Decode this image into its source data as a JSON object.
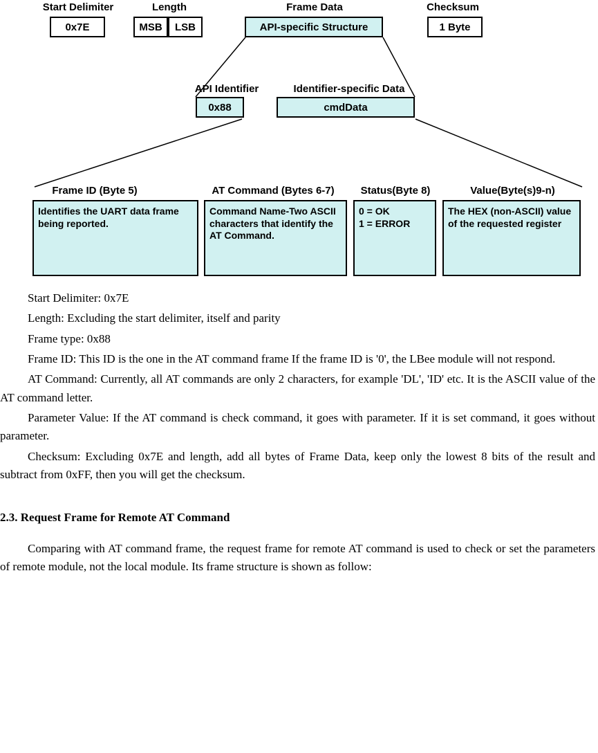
{
  "diagram": {
    "row1": {
      "startDelim": {
        "label": "Start Delimiter",
        "value": "0x7E"
      },
      "length": {
        "label": "Length",
        "msb": "MSB",
        "lsb": "LSB"
      },
      "frameData": {
        "label": "Frame Data",
        "value": "API-specific Structure"
      },
      "checksum": {
        "label": "Checksum",
        "value": "1 Byte"
      }
    },
    "row2": {
      "apiIdentifier": {
        "label": "API Identifier",
        "value": "0x88"
      },
      "identifierData": {
        "label": "Identifier-specific Data",
        "value": "cmdData"
      }
    },
    "row3": {
      "frameId": {
        "label": "Frame ID (Byte 5)",
        "text": "Identifies the UART data frame being reported."
      },
      "atCommand": {
        "label": "AT Command (Bytes 6-7)",
        "text": "Command Name-Two ASCII characters that identify the  AT Command."
      },
      "status": {
        "label": "Status(Byte 8)",
        "text": "0 = OK\n1 = ERROR"
      },
      "value": {
        "label": "Value(Byte(s)9-n)",
        "text": "The HEX (non-ASCII) value of the requested register"
      }
    }
  },
  "definitions": {
    "startDelim": "Start Delimiter: 0x7E",
    "length": "Length: Excluding the start delimiter, itself and parity",
    "frameType": "Frame type: 0x88",
    "frameId": "Frame ID: This ID is the one in the AT command frame If the frame ID is '0', the LBee module will not respond.",
    "atCommand": "AT Command: Currently, all AT commands are only 2 characters, for example 'DL', 'ID' etc. It is the ASCII value of the AT command letter.",
    "paramValue": "Parameter Value: If the AT command is check command, it goes with parameter. If it is set command, it goes without parameter.",
    "checksum": "Checksum: Excluding 0x7E and length, add all bytes of Frame Data, keep only the lowest 8 bits of the result and subtract from 0xFF, then you will get the checksum."
  },
  "section": {
    "heading": "2.3. Request Frame for Remote AT Command",
    "paragraph": "Comparing with AT command frame, the request frame for remote AT command is used to check or set the parameters of remote module, not the local module. Its frame structure is shown as follow:"
  }
}
